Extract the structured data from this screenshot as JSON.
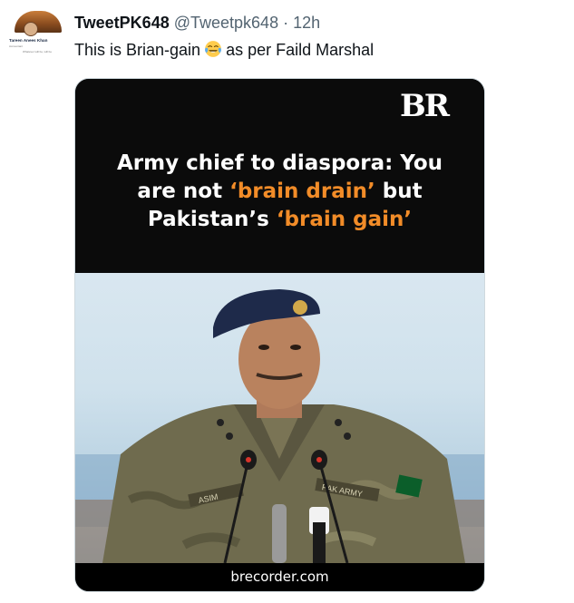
{
  "author": {
    "display_name": "TweetPK648",
    "handle": "@Tweetpk648",
    "separator": "·",
    "time": "12h",
    "avatar_name": "Tareen Anees Khan",
    "avatar_subtitle": "Accountant",
    "avatar_quote": "Whatever will be, will be"
  },
  "tweet": {
    "text_before": "This is Brian-gain",
    "emoji": "face-with-tears-of-joy",
    "text_after": "as per Faild Marshal"
  },
  "media": {
    "logo": "BR",
    "headline_line1": "Army chief to diaspora: You",
    "headline_line2_pre": "are not ",
    "headline_line2_hl": "‘brain drain’",
    "headline_line2_post": " but",
    "headline_line3_pre": "Pakistan’s ",
    "headline_line3_hl": "‘brain gain’",
    "source": "brecorder.com",
    "name_tag": "ASIM",
    "army_tag": "PAK ARMY",
    "highlight_color": "#f28c28"
  }
}
